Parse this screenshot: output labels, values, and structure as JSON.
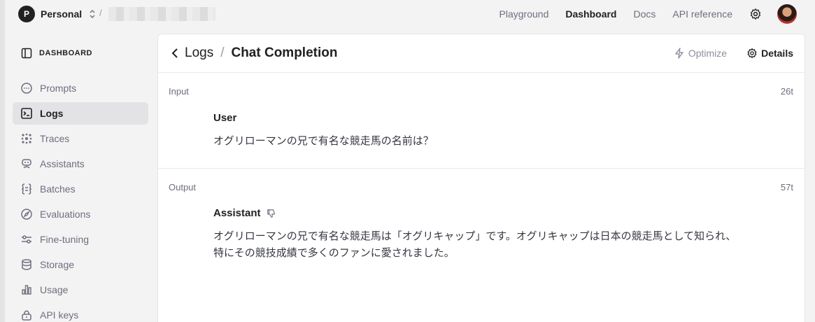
{
  "org": {
    "initial": "P",
    "name": "Personal"
  },
  "topnav": {
    "items": [
      {
        "label": "Playground",
        "active": false
      },
      {
        "label": "Dashboard",
        "active": true
      },
      {
        "label": "Docs",
        "active": false
      },
      {
        "label": "API reference",
        "active": false
      }
    ]
  },
  "sidebar": {
    "header": "DASHBOARD",
    "items": [
      {
        "label": "Prompts",
        "icon": "chat-bubble-icon"
      },
      {
        "label": "Logs",
        "icon": "terminal-icon",
        "active": true
      },
      {
        "label": "Traces",
        "icon": "traces-icon"
      },
      {
        "label": "Assistants",
        "icon": "robot-icon"
      },
      {
        "label": "Batches",
        "icon": "braces-icon"
      },
      {
        "label": "Evaluations",
        "icon": "compass-icon"
      },
      {
        "label": "Fine-tuning",
        "icon": "sliders-icon"
      },
      {
        "label": "Storage",
        "icon": "database-icon"
      },
      {
        "label": "Usage",
        "icon": "bar-chart-icon"
      },
      {
        "label": "API keys",
        "icon": "lock-icon"
      }
    ]
  },
  "header": {
    "back_label": "Logs",
    "title": "Chat Completion",
    "optimize_label": "Optimize",
    "details_label": "Details"
  },
  "input": {
    "label": "Input",
    "tokens": "26t",
    "role": "User",
    "text": "オグリローマンの兄で有名な競走馬の名前は？"
  },
  "output": {
    "label": "Output",
    "tokens": "57t",
    "role": "Assistant",
    "line1": "オグリローマンの兄で有名な競走馬は「オグリキャップ」です。オグリキャップは日本の競走馬として知られ、",
    "line2": "特にその競技成績で多くのファンに愛されました。"
  },
  "colors": {
    "accent": "#202123",
    "muted": "#6e6e80",
    "active_bg": "#e3e3e6"
  }
}
